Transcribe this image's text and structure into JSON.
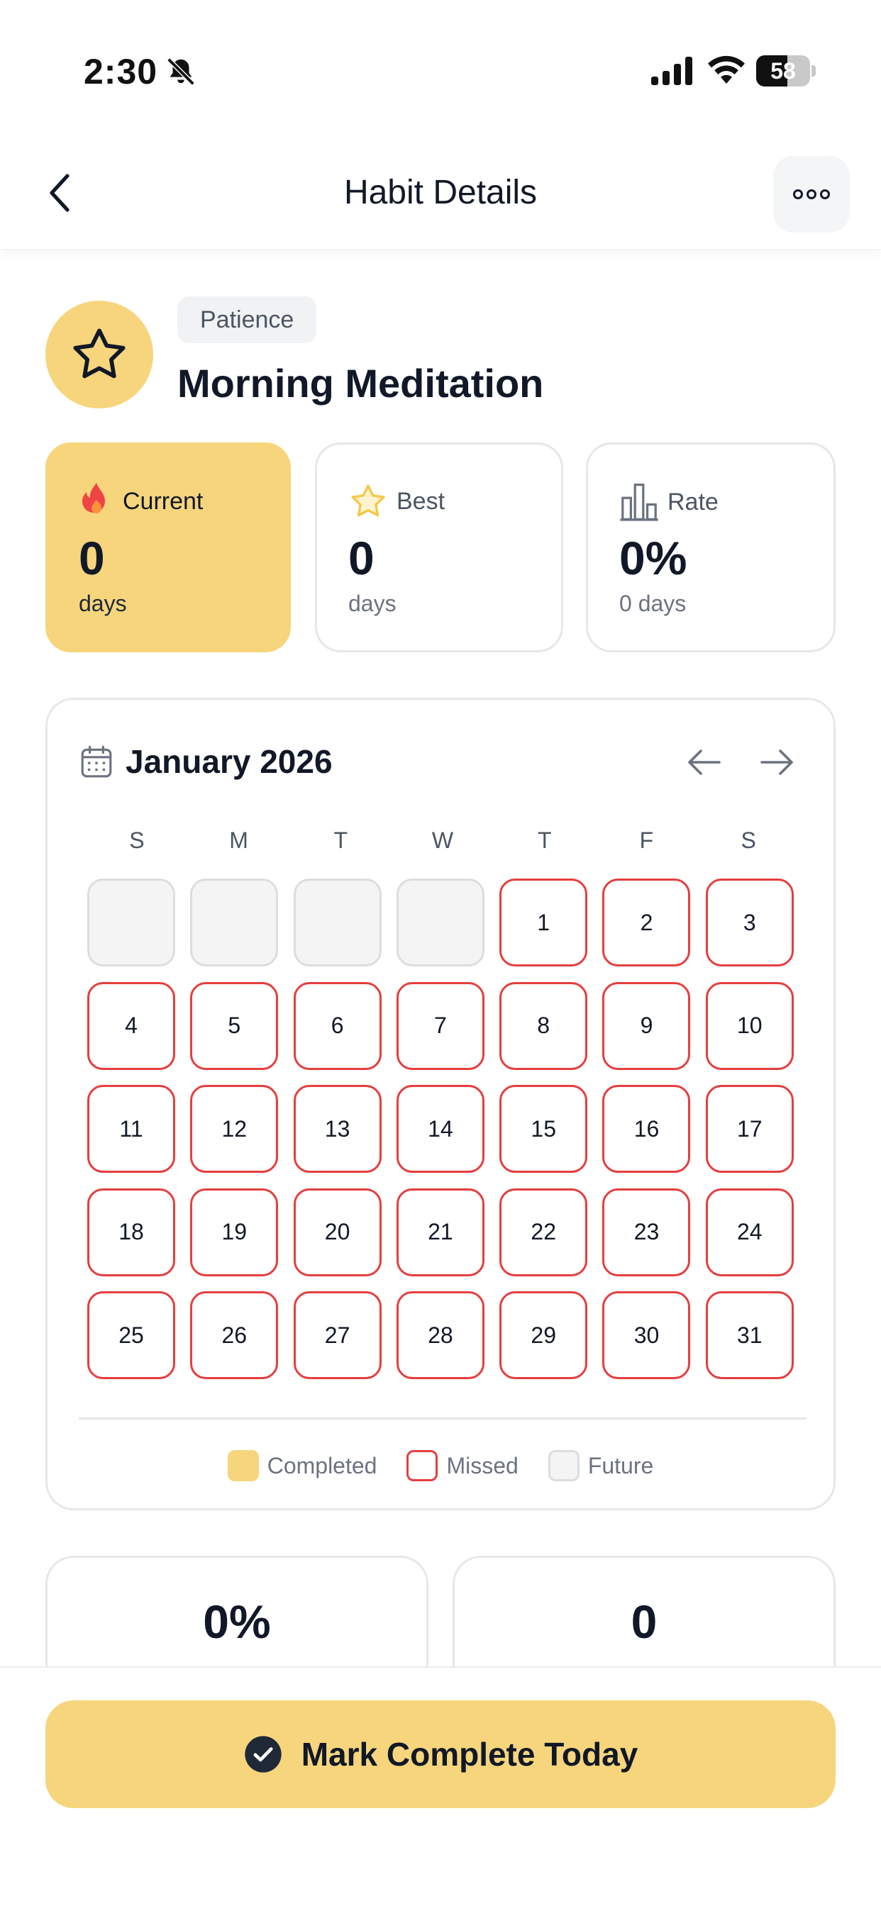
{
  "status_bar": {
    "time": "2:30",
    "battery_level": "58",
    "battery_fraction": 0.58
  },
  "header": {
    "title": "Habit Details",
    "back_icon": "chevron-left-icon",
    "more_icon": "more-horizontal-icon"
  },
  "habit": {
    "category": "Patience",
    "name": "Morning Meditation",
    "icon": "star-icon",
    "accent_color": "#f6d57d"
  },
  "stats": {
    "current": {
      "label": "Current",
      "value": "0",
      "unit": "days",
      "icon": "fire-icon"
    },
    "best": {
      "label": "Best",
      "value": "0",
      "unit": "days",
      "icon": "star-icon"
    },
    "rate": {
      "label": "Rate",
      "value": "0%",
      "unit": "0 days",
      "icon": "bar-chart-icon"
    }
  },
  "calendar": {
    "title": "January 2026",
    "weekdays": [
      "S",
      "M",
      "T",
      "W",
      "T",
      "F",
      "S"
    ],
    "days": [
      {
        "label": "",
        "status": "future"
      },
      {
        "label": "",
        "status": "future"
      },
      {
        "label": "",
        "status": "future"
      },
      {
        "label": "",
        "status": "future"
      },
      {
        "label": "1",
        "status": "missed"
      },
      {
        "label": "2",
        "status": "missed"
      },
      {
        "label": "3",
        "status": "missed"
      },
      {
        "label": "4",
        "status": "missed"
      },
      {
        "label": "5",
        "status": "missed"
      },
      {
        "label": "6",
        "status": "missed"
      },
      {
        "label": "7",
        "status": "missed"
      },
      {
        "label": "8",
        "status": "missed"
      },
      {
        "label": "9",
        "status": "missed"
      },
      {
        "label": "10",
        "status": "missed"
      },
      {
        "label": "11",
        "status": "missed"
      },
      {
        "label": "12",
        "status": "missed"
      },
      {
        "label": "13",
        "status": "missed"
      },
      {
        "label": "14",
        "status": "missed"
      },
      {
        "label": "15",
        "status": "missed"
      },
      {
        "label": "16",
        "status": "missed"
      },
      {
        "label": "17",
        "status": "missed"
      },
      {
        "label": "18",
        "status": "missed"
      },
      {
        "label": "19",
        "status": "missed"
      },
      {
        "label": "20",
        "status": "missed"
      },
      {
        "label": "21",
        "status": "missed"
      },
      {
        "label": "22",
        "status": "missed"
      },
      {
        "label": "23",
        "status": "missed"
      },
      {
        "label": "24",
        "status": "missed"
      },
      {
        "label": "25",
        "status": "missed"
      },
      {
        "label": "26",
        "status": "missed"
      },
      {
        "label": "27",
        "status": "missed"
      },
      {
        "label": "28",
        "status": "missed"
      },
      {
        "label": "29",
        "status": "missed"
      },
      {
        "label": "30",
        "status": "missed"
      },
      {
        "label": "31",
        "status": "missed"
      }
    ],
    "legend": {
      "completed": "Completed",
      "missed": "Missed",
      "future": "Future"
    },
    "colors": {
      "completed": "#f6d57d",
      "missed": "#e53e3e",
      "future": "#f4f4f5"
    }
  },
  "summary": {
    "completion_rate": {
      "value": "0%"
    },
    "total": {
      "value": "0"
    }
  },
  "action": {
    "mark_complete_label": "Mark Complete Today",
    "icon": "check-circle-icon"
  }
}
